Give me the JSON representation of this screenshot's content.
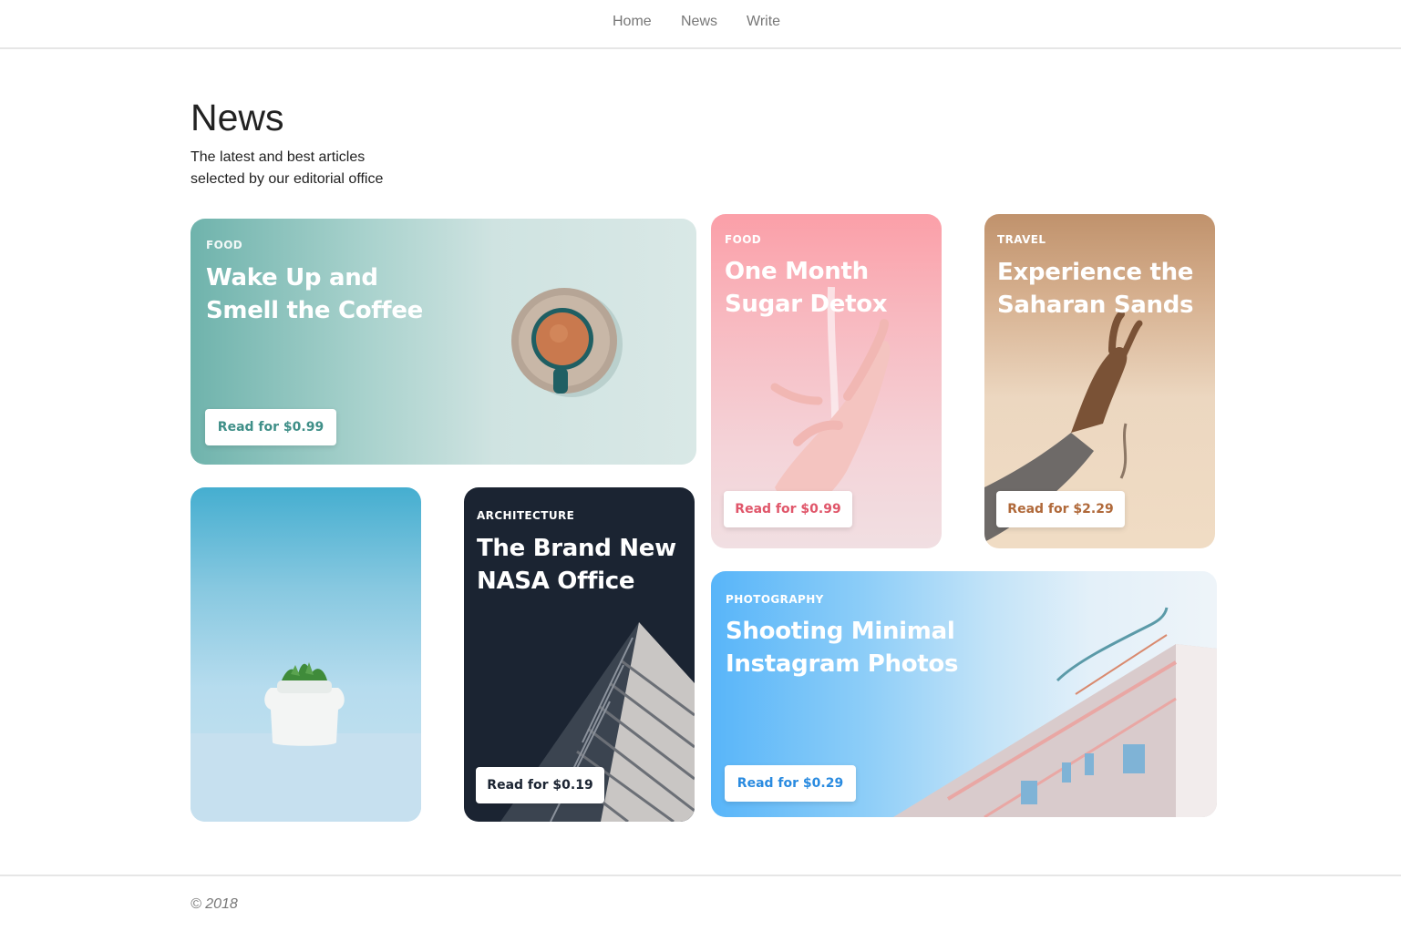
{
  "nav": {
    "items": [
      "Home",
      "News",
      "Write"
    ]
  },
  "header": {
    "title": "News",
    "subtitle_line1": "The latest and best articles",
    "subtitle_line2": "selected by our editorial office"
  },
  "cards": {
    "coffee": {
      "category": "FOOD",
      "title_line1": "Wake Up and",
      "title_line2": "Smell the Coffee",
      "button": "Read for $0.99",
      "accent": "#3f8f88"
    },
    "detox": {
      "category": "FOOD",
      "title_line1": "One Month",
      "title_line2": "Sugar Detox",
      "button": "Read for $0.99",
      "accent": "#e0566a"
    },
    "sahara": {
      "category": "TRAVEL",
      "title_line1": "Experience the",
      "title_line2": "Saharan Sands",
      "button": "Read for $2.29",
      "accent": "#b0693a"
    },
    "nasa": {
      "category": "ARCHITECTURE",
      "title_line1": "The Brand New",
      "title_line2": "NASA Office",
      "button": "Read for $0.19",
      "accent": "#1b2432"
    },
    "instagram": {
      "category": "PHOTOGRAPHY",
      "title_line1": "Shooting Minimal",
      "title_line2": "Instagram Photos",
      "button": "Read for $0.29",
      "accent": "#2a8be0"
    }
  },
  "footer": {
    "copyright": "© 2018"
  }
}
